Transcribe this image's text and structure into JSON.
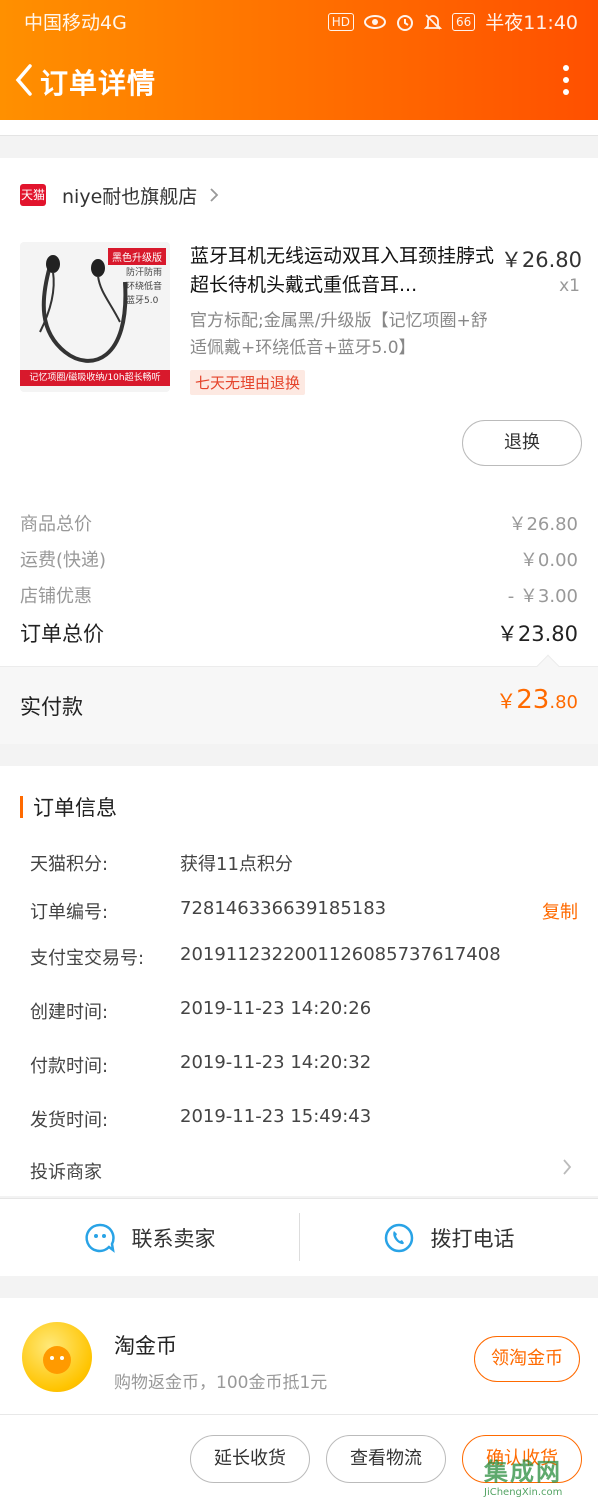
{
  "status_bar": {
    "carrier": "中国移动4G",
    "net_label": "4G",
    "hd": "HD",
    "battery": "66",
    "time": "半夜11:40"
  },
  "titlebar": {
    "title": "订单详情"
  },
  "shop": {
    "logo_text": "天猫",
    "name": "niye耐也旗舰店"
  },
  "product": {
    "title": "蓝牙耳机无线运动双耳入耳颈挂脖式超长待机头戴式重低音耳...",
    "price": "￥26.80",
    "qty": "x1",
    "sku": "官方标配;金属黑/升级版【记忆项圈+舒适佩戴+环绕低音+蓝牙5.0】",
    "tag": "七天无理由退换",
    "image_badge": "黑色升级版",
    "image_features": [
      "防汗防雨",
      "环绕低音",
      "蓝牙5.0"
    ],
    "image_footer": "记忆项圈/磁吸收纳/10h超长畅听",
    "return_button": "退换"
  },
  "summary": {
    "goods_label": "商品总价",
    "goods_value": "￥26.80",
    "shipping_label": "运费(快递)",
    "shipping_value": "￥0.00",
    "discount_label": "店铺优惠",
    "discount_value": "- ￥3.00",
    "total_label": "订单总价",
    "total_value": "￥23.80",
    "paid_label": "实付款",
    "paid_symbol": "￥",
    "paid_int": "23",
    "paid_dec": ".80"
  },
  "info": {
    "title": "订单信息",
    "points_label": "天猫积分:",
    "points_value": "获得11点积分",
    "order_no_label": "订单编号:",
    "order_no_value": "728146336639185183",
    "copy_label": "复制",
    "alipay_label": "支付宝交易号:",
    "alipay_value": "2019112322001126085737617408",
    "created_label": "创建时间:",
    "created_value": "2019-11-23 14:20:26",
    "paid_time_label": "付款时间:",
    "paid_time_value": "2019-11-23 14:20:32",
    "ship_time_label": "发货时间:",
    "ship_time_value": "2019-11-23 15:49:43",
    "complain_label": "投诉商家"
  },
  "contact": {
    "seller": "联系卖家",
    "call": "拨打电话"
  },
  "coin": {
    "title": "淘金币",
    "subtitle": "购物返金币，100金币抵1元",
    "button": "领淘金币"
  },
  "bottom": {
    "extend": "延长收货",
    "logistics": "查看物流",
    "confirm": "确认收货"
  },
  "watermark": {
    "main": "集成网",
    "sub": "JiChengXin.com"
  },
  "colors": {
    "accent": "#ff6a00",
    "header_start": "#ff9000",
    "header_end": "#ff5000",
    "tmall_red": "#e2142d"
  }
}
